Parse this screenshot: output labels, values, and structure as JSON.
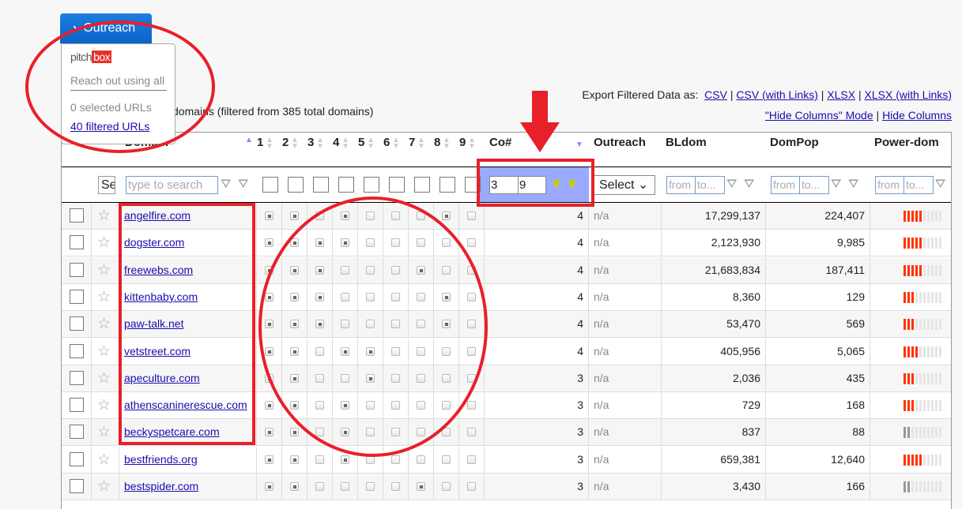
{
  "outreach": {
    "button": "Outreach",
    "logo_text": "pitchbox",
    "reach_placeholder": "Reach out using all",
    "selected": "0 selected URLs",
    "filtered": "40 filtered URLs"
  },
  "summary": "domains (filtered from 385 total domains)",
  "export": {
    "label": "Export Filtered Data as:",
    "csv": "CSV",
    "csv_links": "CSV (with Links)",
    "xlsx": "XLSX",
    "xlsx_links": "XLSX (with Links)",
    "hide_mode": "\"Hide Columns\" Mode",
    "hide": "Hide Columns"
  },
  "columns": {
    "domain": "Domain",
    "nums": [
      "1",
      "2",
      "3",
      "4",
      "5",
      "6",
      "7",
      "8",
      "9"
    ],
    "co": "Co#",
    "outreach": "Outreach",
    "bldom": "BLdom",
    "dompop": "DomPop",
    "power": "Power-dom"
  },
  "filters": {
    "select_short": "Se",
    "search_placeholder": "type to search",
    "co_from": "3",
    "co_to": "9",
    "outreach_select": "Select",
    "from": "from",
    "to": "to..."
  },
  "colors": {
    "power_red": "#ff3300",
    "power_gray": "#999999",
    "annotation": "#e8202a",
    "highlight": "#99aaff"
  },
  "rows": [
    {
      "domain": "angelfire.com",
      "checks": [
        1,
        1,
        0,
        1,
        0,
        0,
        0,
        1,
        0
      ],
      "co": "4",
      "outreach": "n/a",
      "bldom": "17,299,137",
      "dompop": "224,407",
      "power": 5,
      "power_color": "red"
    },
    {
      "domain": "dogster.com",
      "checks": [
        1,
        1,
        1,
        1,
        0,
        0,
        0,
        0,
        0
      ],
      "co": "4",
      "outreach": "n/a",
      "bldom": "2,123,930",
      "dompop": "9,985",
      "power": 5,
      "power_color": "red"
    },
    {
      "domain": "freewebs.com",
      "checks": [
        1,
        1,
        1,
        0,
        0,
        0,
        1,
        0,
        0
      ],
      "co": "4",
      "outreach": "n/a",
      "bldom": "21,683,834",
      "dompop": "187,411",
      "power": 5,
      "power_color": "red"
    },
    {
      "domain": "kittenbaby.com",
      "checks": [
        1,
        1,
        1,
        0,
        0,
        0,
        0,
        1,
        0
      ],
      "co": "4",
      "outreach": "n/a",
      "bldom": "8,360",
      "dompop": "129",
      "power": 3,
      "power_color": "red"
    },
    {
      "domain": "paw-talk.net",
      "checks": [
        1,
        1,
        1,
        0,
        0,
        0,
        0,
        1,
        0
      ],
      "co": "4",
      "outreach": "n/a",
      "bldom": "53,470",
      "dompop": "569",
      "power": 3,
      "power_color": "red"
    },
    {
      "domain": "vetstreet.com",
      "checks": [
        1,
        1,
        0,
        1,
        1,
        0,
        0,
        0,
        0
      ],
      "co": "4",
      "outreach": "n/a",
      "bldom": "405,956",
      "dompop": "5,065",
      "power": 4,
      "power_color": "red"
    },
    {
      "domain": "apeculture.com",
      "checks": [
        1,
        1,
        0,
        0,
        1,
        0,
        0,
        0,
        0
      ],
      "co": "3",
      "outreach": "n/a",
      "bldom": "2,036",
      "dompop": "435",
      "power": 3,
      "power_color": "red"
    },
    {
      "domain": "athenscaninerescue.com",
      "checks": [
        1,
        1,
        0,
        1,
        0,
        0,
        0,
        0,
        0
      ],
      "co": "3",
      "outreach": "n/a",
      "bldom": "729",
      "dompop": "168",
      "power": 3,
      "power_color": "red"
    },
    {
      "domain": "beckyspetcare.com",
      "checks": [
        1,
        1,
        0,
        1,
        0,
        0,
        0,
        0,
        0
      ],
      "co": "3",
      "outreach": "n/a",
      "bldom": "837",
      "dompop": "88",
      "power": 2,
      "power_color": "gray"
    },
    {
      "domain": "bestfriends.org",
      "checks": [
        1,
        1,
        0,
        1,
        0,
        0,
        0,
        0,
        0
      ],
      "co": "3",
      "outreach": "n/a",
      "bldom": "659,381",
      "dompop": "12,640",
      "power": 5,
      "power_color": "red"
    },
    {
      "domain": "bestspider.com",
      "checks": [
        1,
        1,
        0,
        0,
        0,
        0,
        1,
        0,
        0
      ],
      "co": "3",
      "outreach": "n/a",
      "bldom": "3,430",
      "dompop": "166",
      "power": 2,
      "power_color": "gray"
    }
  ]
}
